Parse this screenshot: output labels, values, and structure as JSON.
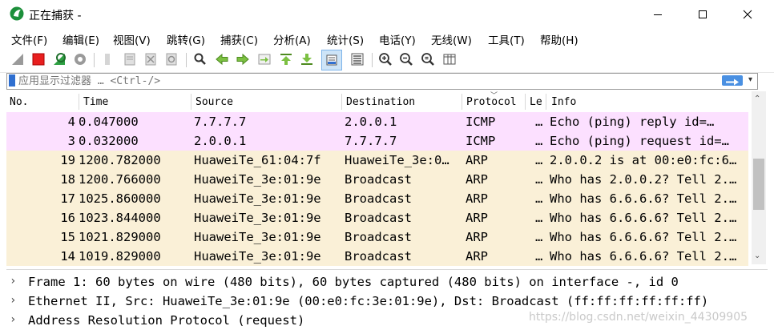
{
  "window": {
    "title": "正在捕获 -"
  },
  "menu": [
    "文件(F)",
    "编辑(E)",
    "视图(V)",
    "跳转(G)",
    "捕获(C)",
    "分析(A)",
    "统计(S)",
    "电话(Y)",
    "无线(W)",
    "工具(T)",
    "帮助(H)"
  ],
  "toolbar": {
    "icons": [
      "shark-fin-start-icon",
      "stop-capture-icon",
      "restart-capture-icon",
      "capture-options-icon",
      "open-file-icon",
      "save-file-icon",
      "close-file-icon",
      "reload-file-icon",
      "find-packet-icon",
      "go-back-icon",
      "go-forward-icon",
      "go-to-packet-icon",
      "go-first-icon",
      "go-last-icon",
      "auto-scroll-icon",
      "colorize-icon",
      "zoom-in-icon",
      "zoom-out-icon",
      "zoom-normal-icon",
      "resize-columns-icon"
    ]
  },
  "filter": {
    "placeholder": "应用显示过滤器 … <Ctrl-/>"
  },
  "columns": [
    "No.",
    "Time",
    "Source",
    "Destination",
    "Protocol",
    "Le",
    "Info"
  ],
  "packets": [
    {
      "no": "4",
      "time": "0.047000",
      "source": "7.7.7.7",
      "destination": "2.0.0.1",
      "protocol": "ICMP",
      "length": "…",
      "info": "Echo (ping) reply    id=…",
      "color": "#fce0ff"
    },
    {
      "no": "3",
      "time": "0.032000",
      "source": "2.0.0.1",
      "destination": "7.7.7.7",
      "protocol": "ICMP",
      "length": "…",
      "info": "Echo (ping) request  id=…",
      "color": "#fce0ff"
    },
    {
      "no": "19",
      "time": "1200.782000",
      "source": "HuaweiTe_61:04:7f",
      "destination": "HuaweiTe_3e:0…",
      "protocol": "ARP",
      "length": "…",
      "info": "2.0.0.2 is at 00:e0:fc:6…",
      "color": "#faf0d7"
    },
    {
      "no": "18",
      "time": "1200.766000",
      "source": "HuaweiTe_3e:01:9e",
      "destination": "Broadcast",
      "protocol": "ARP",
      "length": "…",
      "info": "Who has 2.0.0.2? Tell 2.…",
      "color": "#faf0d7"
    },
    {
      "no": "17",
      "time": "1025.860000",
      "source": "HuaweiTe_3e:01:9e",
      "destination": "Broadcast",
      "protocol": "ARP",
      "length": "…",
      "info": "Who has 6.6.6.6? Tell 2.…",
      "color": "#faf0d7"
    },
    {
      "no": "16",
      "time": "1023.844000",
      "source": "HuaweiTe_3e:01:9e",
      "destination": "Broadcast",
      "protocol": "ARP",
      "length": "…",
      "info": "Who has 6.6.6.6? Tell 2.…",
      "color": "#faf0d7"
    },
    {
      "no": "15",
      "time": "1021.829000",
      "source": "HuaweiTe_3e:01:9e",
      "destination": "Broadcast",
      "protocol": "ARP",
      "length": "…",
      "info": "Who has 6.6.6.6? Tell 2.…",
      "color": "#faf0d7"
    },
    {
      "no": "14",
      "time": "1019.829000",
      "source": "HuaweiTe_3e:01:9e",
      "destination": "Broadcast",
      "protocol": "ARP",
      "length": "…",
      "info": "Who has 6.6.6.6? Tell 2.…",
      "color": "#faf0d7"
    }
  ],
  "details": [
    "Frame 1: 60 bytes on wire (480 bits), 60 bytes captured (480 bits) on interface -, id 0",
    "Ethernet II, Src: HuaweiTe_3e:01:9e (00:e0:fc:3e:01:9e), Dst: Broadcast (ff:ff:ff:ff:ff:ff)",
    "Address Resolution Protocol (request)"
  ],
  "watermark": "https://blog.csdn.net/weixin_44309905"
}
